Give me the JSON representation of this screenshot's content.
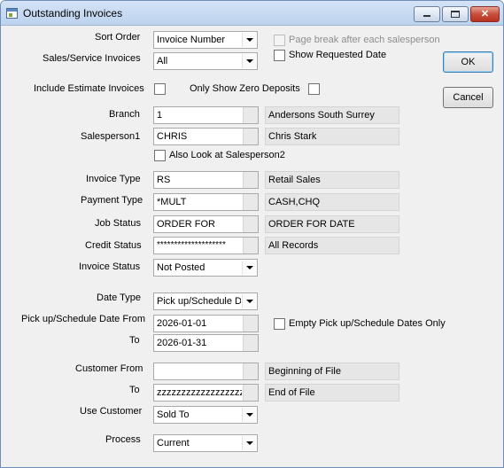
{
  "window": {
    "title": "Outstanding Invoices",
    "controls": {
      "minimize": "minimize-icon",
      "maximize": "maximize-icon",
      "close": "close-icon",
      "close_glyph": "✕"
    }
  },
  "form": {
    "sort_order": {
      "label": "Sort Order",
      "value": "Invoice Number"
    },
    "page_break": {
      "label": "Page break after each salesperson",
      "checked": false,
      "enabled": false
    },
    "sales_service": {
      "label": "Sales/Service Invoices",
      "value": "All"
    },
    "show_requested_date": {
      "label": "Show Requested Date",
      "checked": false
    },
    "include_estimate": {
      "label": "Include Estimate Invoices",
      "checked": false
    },
    "only_zero_deposits": {
      "label": "Only Show Zero Deposits",
      "checked": false
    },
    "branch": {
      "label": "Branch",
      "value": "1",
      "description": "Andersons South Surrey"
    },
    "salesperson1": {
      "label": "Salesperson1",
      "value": "CHRIS",
      "description": "Chris Stark"
    },
    "also_salesperson2": {
      "label": "Also Look at Salesperson2",
      "checked": false
    },
    "invoice_type": {
      "label": "Invoice Type",
      "value": "RS",
      "description": "Retail Sales"
    },
    "payment_type": {
      "label": "Payment Type",
      "value": "*MULT",
      "description": "CASH,CHQ"
    },
    "job_status": {
      "label": "Job Status",
      "value": "ORDER FOR",
      "description": "ORDER FOR DATE"
    },
    "credit_status": {
      "label": "Credit Status",
      "value": "********************",
      "description": "All Records"
    },
    "invoice_status": {
      "label": "Invoice Status",
      "value": "Not Posted"
    },
    "date_type": {
      "label": "Date Type",
      "value": "Pick up/Schedule Da"
    },
    "date_from": {
      "label": "Pick up/Schedule Date From",
      "value": "2026-01-01"
    },
    "empty_dates_only": {
      "label": "Empty Pick up/Schedule Dates Only",
      "checked": false
    },
    "date_to": {
      "label": "To",
      "value": "2026-01-31"
    },
    "customer_from": {
      "label": "Customer From",
      "value": "",
      "description": "Beginning of File"
    },
    "customer_to": {
      "label": "To",
      "value": "zzzzzzzzzzzzzzzzzz",
      "description": "End of File"
    },
    "use_customer": {
      "label": "Use Customer",
      "value": "Sold To"
    },
    "process": {
      "label": "Process",
      "value": "Current"
    }
  },
  "buttons": {
    "ok": "OK",
    "cancel": "Cancel"
  }
}
